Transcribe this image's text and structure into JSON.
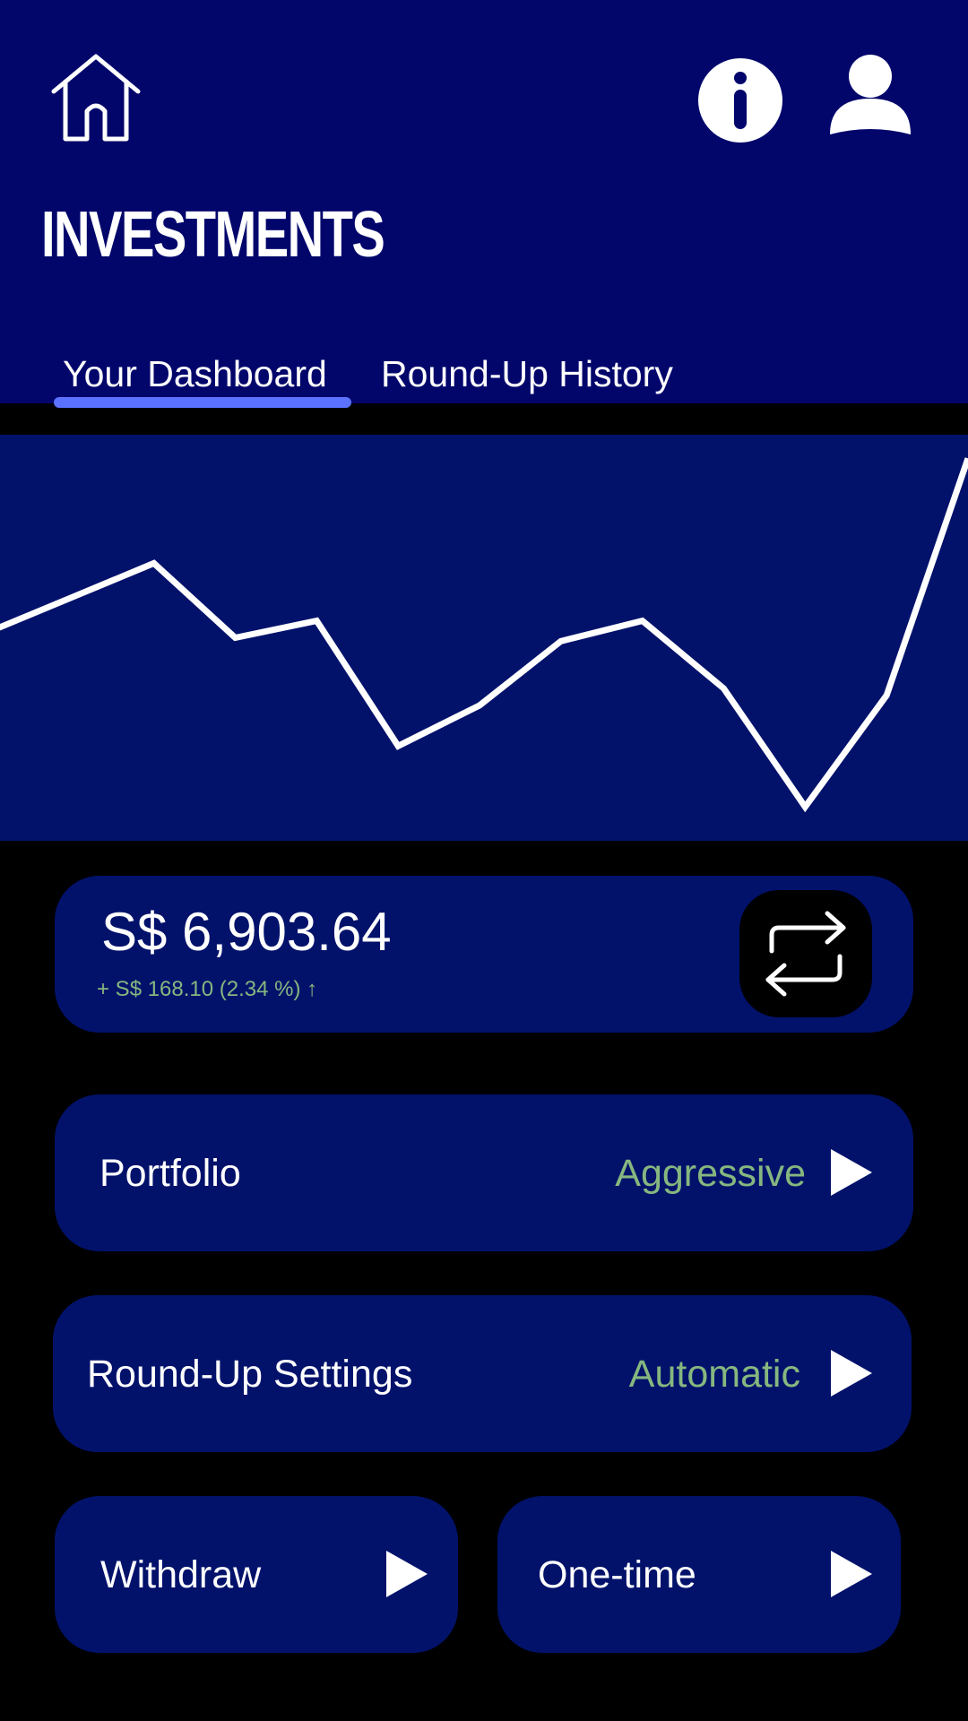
{
  "header": {
    "title": "INVESTMENTS",
    "icons": [
      "home-icon",
      "info-icon",
      "user-icon"
    ]
  },
  "tabs": [
    {
      "label": "Your Dashboard",
      "active": true
    },
    {
      "label": "Round-Up History",
      "active": false
    }
  ],
  "chart_data": {
    "type": "line",
    "title": "",
    "xlabel": "",
    "ylabel": "",
    "grid": false,
    "values": [
      6.42,
      6.52,
      6.62,
      6.4,
      6.45,
      6.08,
      6.2,
      6.39,
      6.45,
      6.25,
      5.9,
      6.23,
      6.93
    ],
    "ylim": [
      5.8,
      7.0
    ],
    "color": "#ffffff"
  },
  "balance": {
    "amount": "S$ 6,903.64",
    "change": "+ S$ 168.10 (2.34 %)  ↑"
  },
  "rows": {
    "portfolio": {
      "label": "Portfolio",
      "value": "Aggressive"
    },
    "roundup": {
      "label": "Round-Up Settings",
      "value": "Automatic"
    },
    "withdraw": {
      "label": "Withdraw"
    },
    "onetime": {
      "label": "One-time"
    }
  },
  "colors": {
    "header_bg": "#02066b",
    "card_bg": "#02126b",
    "accent_green": "#86b77f",
    "tab_underline": "#5a72ff"
  }
}
